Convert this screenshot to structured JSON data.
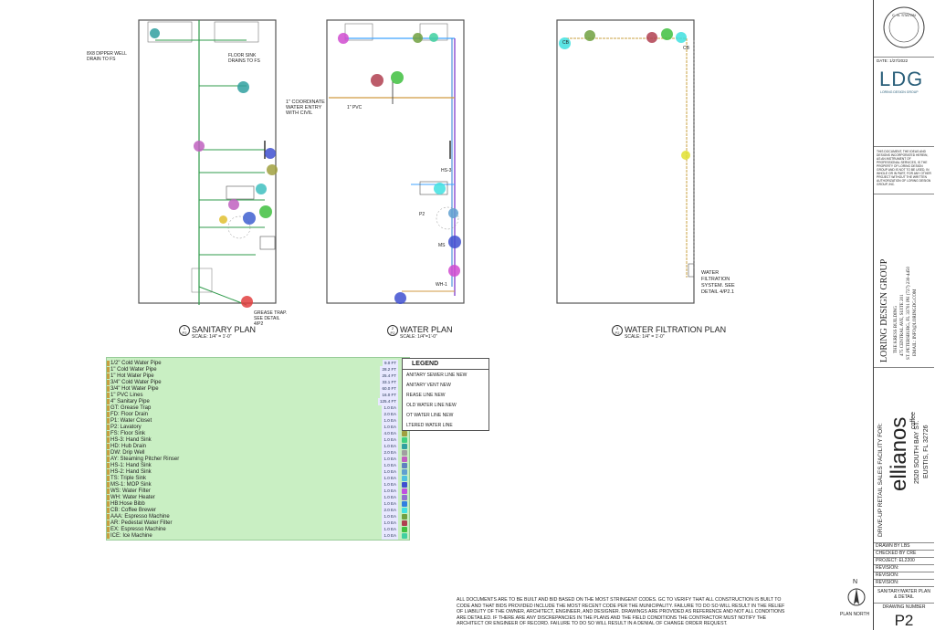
{
  "plans": {
    "sanitary": {
      "number": "1",
      "sheet": "P2",
      "title": "SANITARY PLAN",
      "scale": "SCALE: 1/4\" = 1'-0\""
    },
    "water": {
      "number": "2",
      "sheet": "P2",
      "title": "WATER PLAN",
      "scale": "SCALE: 1/4\"=1'-0\""
    },
    "filtration": {
      "number": "3",
      "sheet": "P2",
      "title": "WATER FILTRATION PLAN",
      "scale": "SCALE: 1/4\" = 1'-0\""
    }
  },
  "sanitary_notes": {
    "ref_drain": "8X8 DIPPER WELL DRAIN TO FS",
    "floor_sink": "FLOOR SINK DRAINS TO FS",
    "grease_trap": "GREASE TRAP. SEE DETAIL 4/P2"
  },
  "water_notes": {
    "coordinate": "1\" COORDINATE WATER ENTRY WITH CIVIL",
    "pvc": "1\" PVC",
    "hs3": "HS-3",
    "ms": "MS",
    "wh": "WH-1",
    "p2": "P2"
  },
  "filtration_notes": {
    "cb_left": "CB",
    "cb_right": "CB",
    "system": "WATER FILTRATION SYSTEM. SEE DETAIL 4/P2.1"
  },
  "takeoff": [
    {
      "name": "1/2\" Cold Water Pipe",
      "qty": "9.0 FT",
      "color": "#3fa3ff"
    },
    {
      "name": "1\" Cold Water Pipe",
      "qty": "28.2 FT",
      "color": "#2d7fd6"
    },
    {
      "name": "1\" Hot Water Pipe",
      "qty": "25.4 FT",
      "color": "#d04bd0"
    },
    {
      "name": "3/4\" Cold Water Pipe",
      "qty": "33.1 FT",
      "color": "#7ab6ff"
    },
    {
      "name": "3/4\" Hot Water Pipe",
      "qty": "60.0 FT",
      "color": "#8a4bd0"
    },
    {
      "name": "1\" PVC Lines",
      "qty": "16.0 FT",
      "color": "#d09a40"
    },
    {
      "name": "4\" Sanitary Pipe",
      "qty": "125.4 FT",
      "color": "#2f9b4b"
    },
    {
      "name": "GT: Grease Trap",
      "qty": "1.0 EA",
      "color": "#e24040"
    },
    {
      "name": "FD: Floor Drain",
      "qty": "2.0 EA",
      "color": "#4060d0"
    },
    {
      "name": "P1: Water Closet",
      "qty": "1.0 EA",
      "color": "#e0c030"
    },
    {
      "name": "P2: Lavatory",
      "qty": "1.0 EA",
      "color": "#40c0c0"
    },
    {
      "name": "FS: Floor Sink",
      "qty": "4.0 EA",
      "color": "#a0a040"
    },
    {
      "name": "HS-3: Hand Sink",
      "qty": "1.0 EA",
      "color": "#40d080"
    },
    {
      "name": "HD: Hub Drain",
      "qty": "1.0 EA",
      "color": "#30a0a0"
    },
    {
      "name": "DW: Drip Well",
      "qty": "2.0 EA",
      "color": "#a0a0a0"
    },
    {
      "name": "AY: Steaming Pitcher Rinser",
      "qty": "1.0 EA",
      "color": "#c060c0"
    },
    {
      "name": "HS-1: Hand Sink",
      "qty": "1.0 EA",
      "color": "#6080c0"
    },
    {
      "name": "HS-2: Hand Sink",
      "qty": "1.0 EA",
      "color": "#60a0d0"
    },
    {
      "name": "TS: Triple Sink",
      "qty": "1.0 EA",
      "color": "#50c0e0"
    },
    {
      "name": "MS-1: MOP Sink",
      "qty": "1.0 EA",
      "color": "#4050d0"
    },
    {
      "name": "WS: Water Filter",
      "qty": "1.0 EA",
      "color": "#c050e0"
    },
    {
      "name": "WH: Water Heater",
      "qty": "1.0 EA",
      "color": "#9070d0"
    },
    {
      "name": "HB:Hose Bibb",
      "qty": "1.0 EA",
      "color": "#3080e0"
    },
    {
      "name": "CB: Coffee Brewer",
      "qty": "2.0 EA",
      "color": "#40e0e0"
    },
    {
      "name": "AAA: Espresso Machine",
      "qty": "1.0 EA",
      "color": "#70a040"
    },
    {
      "name": "AR: Pedestal Water Filter",
      "qty": "1.0 EA",
      "color": "#b04050"
    },
    {
      "name": "EX: Espresso Machine",
      "qty": "1.0 EA",
      "color": "#40c040"
    },
    {
      "name": "ICE: Ice Machine",
      "qty": "1.0 EA",
      "color": "#40d0a0"
    }
  ],
  "legend": {
    "title": "LEGEND",
    "items": [
      "ANITARY SEWER LINE NEW",
      "ANITARY VENT NEW",
      "REASE LINE NEW",
      "OLD WATER LINE NEW",
      "OT WATER LINE NEW",
      "LTERED WATER LINE"
    ]
  },
  "general_note": "ALL DOCUMENTS ARE TO BE BUILT AND BID BASED ON THE MOST STRINGENT CODES. GC TO VERIFY THAT ALL CONSTRUCTION IS BUILT TO CODE AND THAT BIDS PROVIDED INCLUDE THE MOST RECENT CODE PER THE MUNICIPALITY. FAILURE TO DO SO WILL RESULT IN THE RELIEF OF LIABILITY OF THE OWNER, ARCHITECT, ENGINEER, AND DESIGNER. DRAWINGS ARE PROVIDED AS REFERENCE AND NOT ALL CONDITIONS ARE DETAILED. IF THERE ARE ANY DISCREPANCIES IN THE PLANS AND THE FIELD CONDITIONS THE CONTRACTOR MUST NOTIFY THE ARCHITECT OR ENGINEER OF RECORD. FAILURE TO DO SO WILL RESULT IN A DENIAL OF CHANGE ORDER REQUEST.",
  "north": {
    "letter": "N",
    "label": "PLAN NORTH"
  },
  "title_block": {
    "seal": "C. N. STATON",
    "date": "DATE: 1/27/2022",
    "logo": "LDG",
    "logo_sub": "LORING DESIGN GROUP",
    "disclaimer": "THIS DOCUMENT, THE IDEAS AND DESIGNS INCORPORATED HEREIN, AS AN INSTRUMENT OF PROFESSIONAL SERVICES, IS THE PROPERTY OF LORING DESIGN GROUP AND IS NOT TO BE USED, IN WHOLE OR IN PART, FOR ANY OTHER PROJECT WITHOUT THE WRITTEN AUTHORIZATION OF LORING DESIGN GROUP, INC.",
    "firm": "LORING DESIGN GROUP",
    "addr1": "THE KRESS BUILDING",
    "addr2": "475 CENTRAL AVE, SUITE 201",
    "addr3": "ST. PETERSBURG, FL 33701 PH (727) 230-4450",
    "addr4": "EMAIL: INFO@LORINGDG.COM",
    "project_desc": "DRIVE-UP RETAIL SALES FACILITY FOR:",
    "client": "ellianos",
    "client_sub": "coffee",
    "street": "2520 SOUTH BAY ST.",
    "city": "EUSTIS, FL 32726",
    "drawn_by": "DRAWN BY LBS",
    "checked_by": "CHECKED BY CRE",
    "project": "PROJECT: EL2200",
    "revision1": "REVISION:",
    "revision2": "REVISION:",
    "revision3": "REVISION:",
    "sheet_title": "SANITARY/WATER PLAN & DETAIL",
    "drawing_number_label": "DRAWING NUMBER",
    "drawing_number": "P2"
  }
}
